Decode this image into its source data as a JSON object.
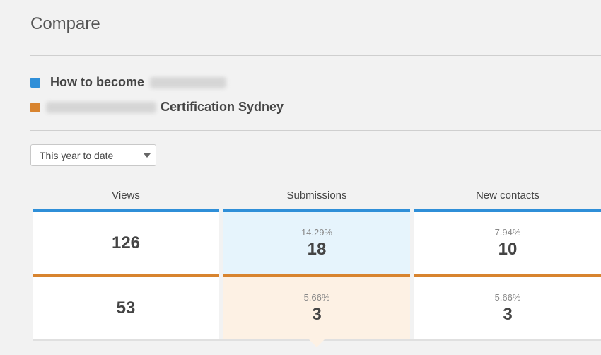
{
  "page": {
    "title": "Compare"
  },
  "legend": [
    {
      "text_before": "How to become",
      "text_after": "",
      "color": "#2f8fd8"
    },
    {
      "text_before": "",
      "text_after": "Certification Sydney",
      "color": "#d8842f"
    }
  ],
  "filter": {
    "selected": "This year to date"
  },
  "columns": [
    "Views",
    "Submissions",
    "New contacts"
  ],
  "rows": [
    {
      "series_color": "#2f8fd8",
      "cells": [
        {
          "pct": "",
          "value": "126"
        },
        {
          "pct": "14.29%",
          "value": "18"
        },
        {
          "pct": "7.94%",
          "value": "10"
        }
      ]
    },
    {
      "series_color": "#d8842f",
      "cells": [
        {
          "pct": "",
          "value": "53"
        },
        {
          "pct": "5.66%",
          "value": "3"
        },
        {
          "pct": "5.66%",
          "value": "3"
        }
      ]
    }
  ]
}
